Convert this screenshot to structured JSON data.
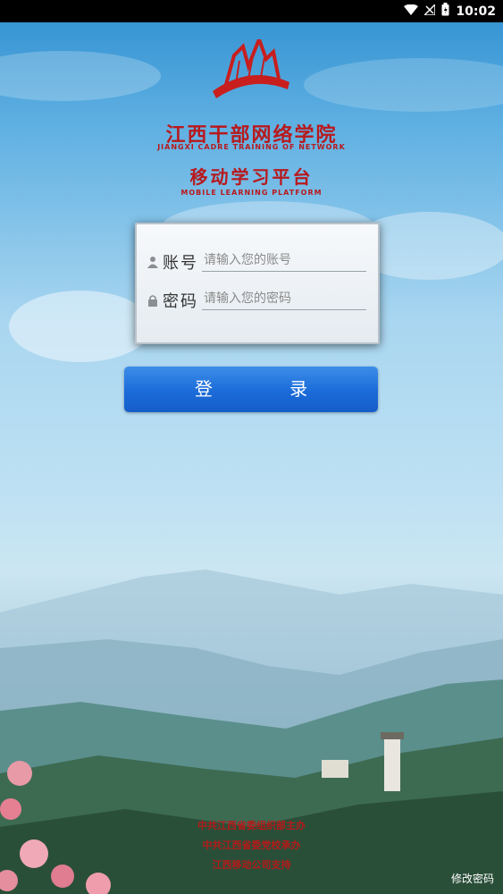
{
  "status_bar": {
    "time": "10:02"
  },
  "header": {
    "title_cn": "江西干部网络学院",
    "title_en": "JIANGXI  CADRE  TRAINING  OF  NETWORK",
    "subtitle_cn": "移动学习平台",
    "subtitle_en": "MOBILE  LEARNING  PLATFORM"
  },
  "login_form": {
    "account_label": "账号",
    "account_placeholder": "请输入您的账号",
    "account_value": "",
    "password_label": "密码",
    "password_placeholder": "请输入您的密码",
    "password_value": ""
  },
  "login_button": "登 录",
  "footer": {
    "line1": "中共江西省委组织部主办",
    "line2": "中共江西省委党校承办",
    "line3": "江西移动公司支持"
  },
  "change_password": "修改密码",
  "colors": {
    "brand_red": "#b8191d",
    "button_blue": "#1b6bd9"
  }
}
